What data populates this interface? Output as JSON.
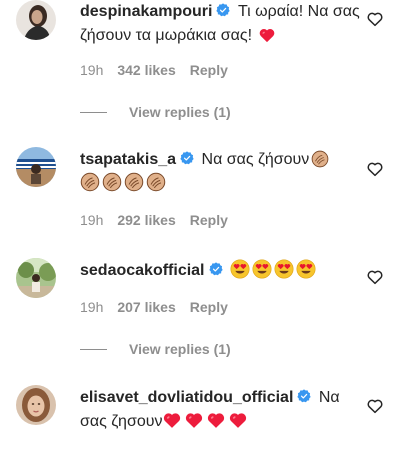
{
  "comments": [
    {
      "username": "despinakampouri",
      "text": "Τι ωραία! Να σας ζήσουν τα μωράκια σας!",
      "time": "19h",
      "likes": "342 likes",
      "reply": "Reply",
      "view_replies": "View replies (1)",
      "emoji": [
        "red-heart"
      ]
    },
    {
      "username": "tsapatakis_a",
      "text": "Να σας ζήσουν",
      "time": "19h",
      "likes": "292 likes",
      "reply": "Reply",
      "emoji": [
        "clapping-hands",
        "clapping-hands",
        "clapping-hands",
        "clapping-hands",
        "clapping-hands"
      ]
    },
    {
      "username": "sedaocakofficial",
      "text": "",
      "time": "19h",
      "likes": "207 likes",
      "reply": "Reply",
      "view_replies": "View replies (1)",
      "emoji": [
        "heart-eyes",
        "heart-eyes",
        "heart-eyes",
        "heart-eyes"
      ]
    },
    {
      "username": "elisavet_dovliatidou_official",
      "text_line1": "Να",
      "text_line2": "σας ζησουν",
      "emoji": [
        "red-heart",
        "red-heart",
        "red-heart",
        "red-heart"
      ]
    }
  ],
  "colors": {
    "text": "#262626",
    "muted": "#8e8e8e",
    "verified": "#3897f0",
    "heart_red": "#ed1c3c",
    "skin": "#e0b08a"
  }
}
